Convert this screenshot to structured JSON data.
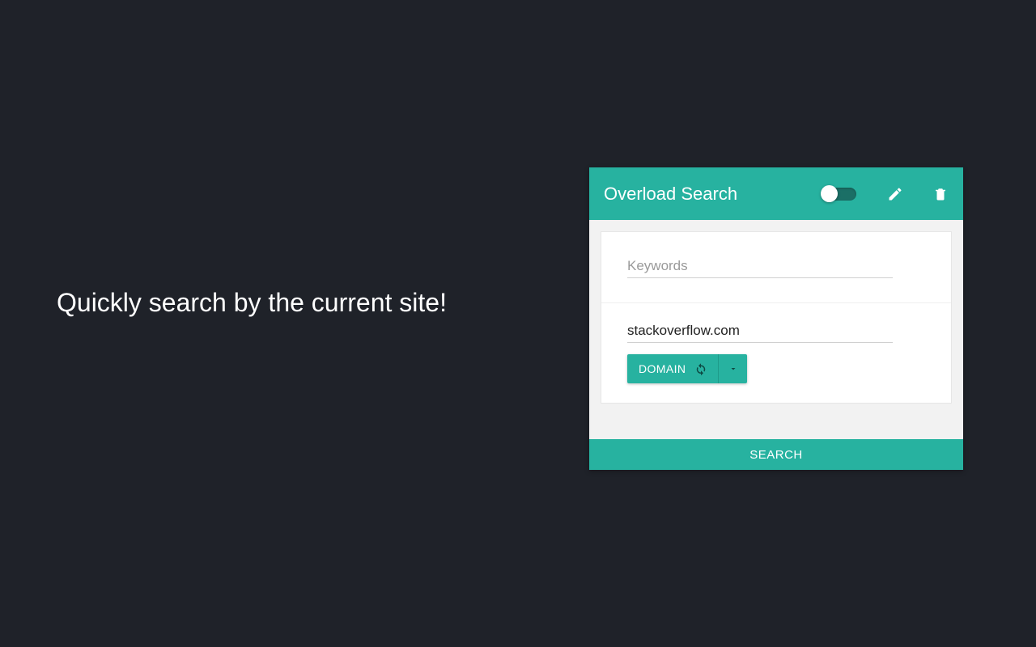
{
  "tagline": "Quickly search by the current site!",
  "popup": {
    "title": "Overload Search",
    "keywords_placeholder": "Keywords",
    "keywords_value": "",
    "domain_value": "stackoverflow.com",
    "domain_button_label": "DOMAIN",
    "search_button_label": "SEARCH"
  }
}
